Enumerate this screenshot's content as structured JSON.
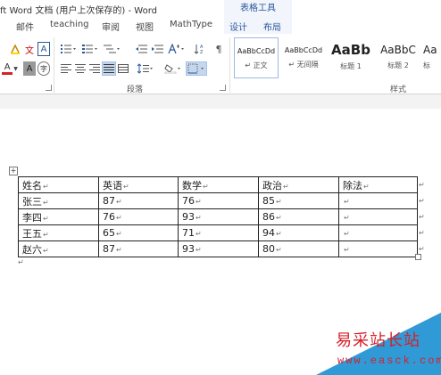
{
  "window": {
    "title": "ft Word 文档 (用户上次保存的) - Word",
    "context_title": "表格工具"
  },
  "tabs": [
    "邮件",
    "teaching",
    "审阅",
    "视图",
    "MathType"
  ],
  "context_tabs": [
    "设计",
    "布局"
  ],
  "ribbon": {
    "groups": {
      "paragraph": "段落",
      "styles": "样式"
    },
    "styles": [
      {
        "preview": "AaBbCcDd",
        "name": "正文",
        "selected": true
      },
      {
        "preview": "AaBbCcDd",
        "name": "无间隔",
        "selected": false
      },
      {
        "preview": "AaBb",
        "name": "标题 1",
        "selected": false
      },
      {
        "preview": "AaBbC",
        "name": "标题 2",
        "selected": false
      },
      {
        "preview": "Aa",
        "name": "标",
        "selected": false
      }
    ],
    "font_icon_letters": {
      "font_color": "A",
      "char_shading": "A",
      "enclose": "字",
      "pinyin": "文",
      "border_a": "A"
    }
  },
  "table": {
    "header": [
      "姓名",
      "英语",
      "数学",
      "政治",
      "除法"
    ],
    "rows": [
      [
        "张三",
        "87",
        "76",
        "85",
        ""
      ],
      [
        "李四",
        "76",
        "93",
        "86",
        ""
      ],
      [
        "王五",
        "65",
        "71",
        "94",
        ""
      ],
      [
        "赵六",
        "87",
        "93",
        "80",
        ""
      ]
    ]
  },
  "watermark": {
    "name": "易采站长站",
    "url": "www.easck.com"
  },
  "colors": {
    "accent": "#2b579a",
    "selected_bg": "#c5d7ef",
    "watermark_red": "#d6202a",
    "watermark_blue": "#2f9ad6"
  }
}
